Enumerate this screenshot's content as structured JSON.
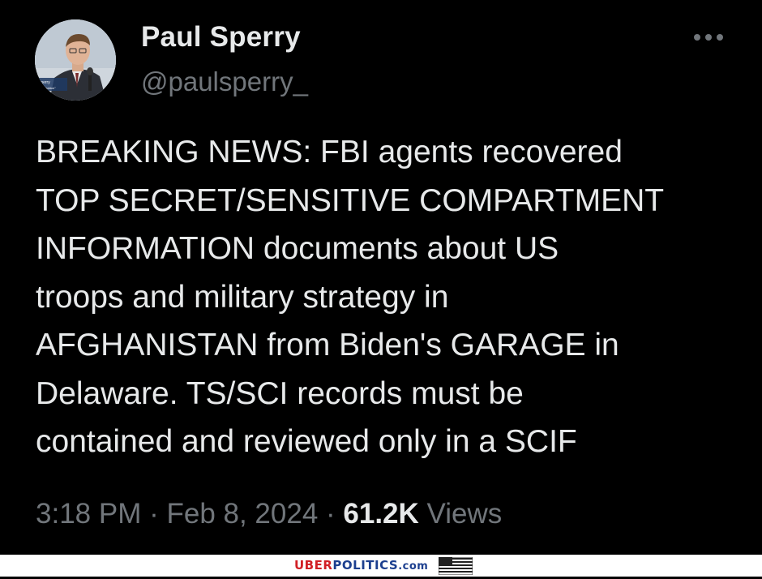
{
  "author": {
    "display_name": "Paul Sperry",
    "handle": "@paulsperry_",
    "avatar_icon": "profile-photo",
    "avatar_caption_line1": "Sperry",
    "avatar_caption_line2": "r, \"Infiltration\""
  },
  "menu": {
    "icon": "more-options-icon"
  },
  "tweet": {
    "text": "BREAKING NEWS:  FBI agents recovered\nTOP SECRET/SENSITIVE COMPARTMENT\nINFORMATION documents about US\ntroops and military strategy in\nAFGHANISTAN from Biden's GARAGE in\nDelaware. TS/SCI records must be\ncontained and reviewed only in a SCIF",
    "time": "3:18 PM",
    "separator": " · ",
    "date": "Feb 8, 2024",
    "views_count": "61.2K",
    "views_label": "Views"
  },
  "watermark": {
    "part1": "UBER",
    "part2": "POLITICS",
    "part3": ".com",
    "flag_icon": "us-flag-icon"
  },
  "colors": {
    "background": "#000000",
    "primary_text": "#e7e9ea",
    "secondary_text": "#71767b",
    "watermark_red": "#d11f25",
    "watermark_blue": "#1c3f8f"
  }
}
